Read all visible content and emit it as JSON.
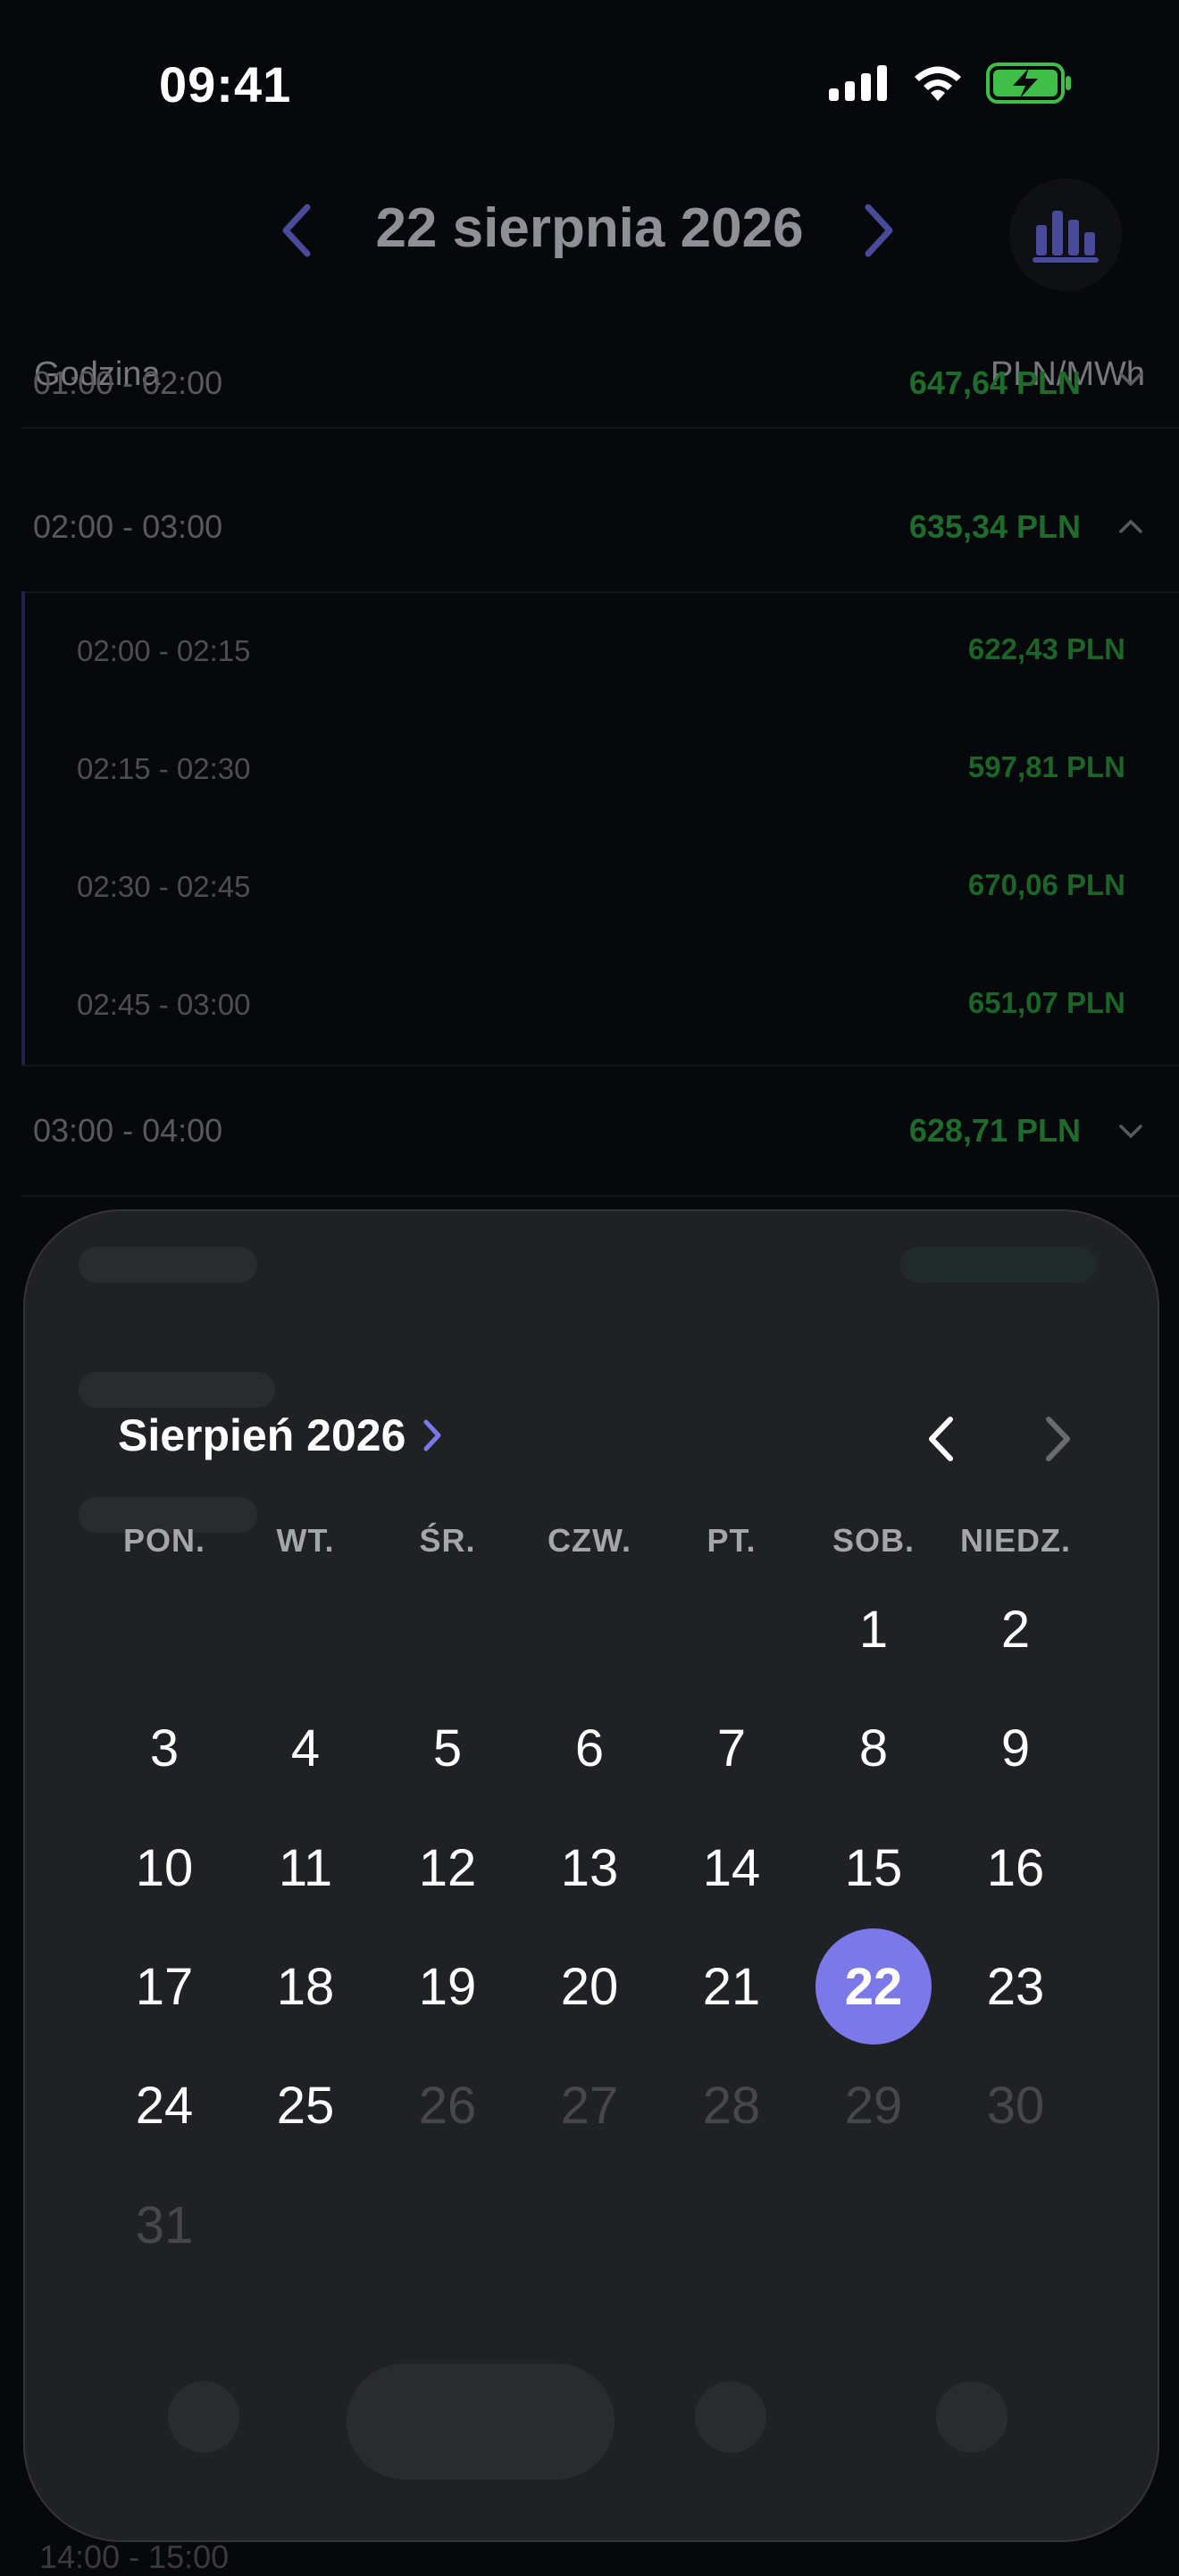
{
  "status_bar": {
    "time": "09:41"
  },
  "header": {
    "title": "22 sierpnia 2026"
  },
  "table": {
    "col_left": "Godzina",
    "col_right": "PLN/MWh",
    "rows": [
      {
        "label": "01:00 - 02:00",
        "value": "647,64 PLN",
        "expanded": false
      },
      {
        "label": "02:00 - 03:00",
        "value": "635,34 PLN",
        "expanded": true
      },
      {
        "label": "03:00 - 04:00",
        "value": "628,71 PLN",
        "expanded": false
      }
    ],
    "sub_rows": [
      {
        "label": "02:00 - 02:15",
        "value": "622,43 PLN"
      },
      {
        "label": "02:15 - 02:30",
        "value": "597,81 PLN"
      },
      {
        "label": "02:30 - 02:45",
        "value": "670,06 PLN"
      },
      {
        "label": "02:45 - 03:00",
        "value": "651,07 PLN"
      }
    ],
    "bottom_row_label": "14:00 - 15:00"
  },
  "calendar": {
    "month_title": "Sierpień 2026",
    "weekdays": [
      "PON.",
      "WT.",
      "ŚR.",
      "CZW.",
      "PT.",
      "SOB.",
      "NIEDZ."
    ],
    "days": [
      "1",
      "2",
      "3",
      "4",
      "5",
      "6",
      "7",
      "8",
      "9",
      "10",
      "11",
      "12",
      "13",
      "14",
      "15",
      "16",
      "17",
      "18",
      "19",
      "20",
      "21",
      "22",
      "23",
      "24",
      "25",
      "26",
      "27",
      "28",
      "29",
      "30",
      "31"
    ],
    "first_weekday_index": 5,
    "selected_day": 22,
    "last_enabled_day": 25
  },
  "colors": {
    "accent": "#7b78ea",
    "price_green": "#1f6b2c",
    "sheet_bg": "#202124"
  }
}
